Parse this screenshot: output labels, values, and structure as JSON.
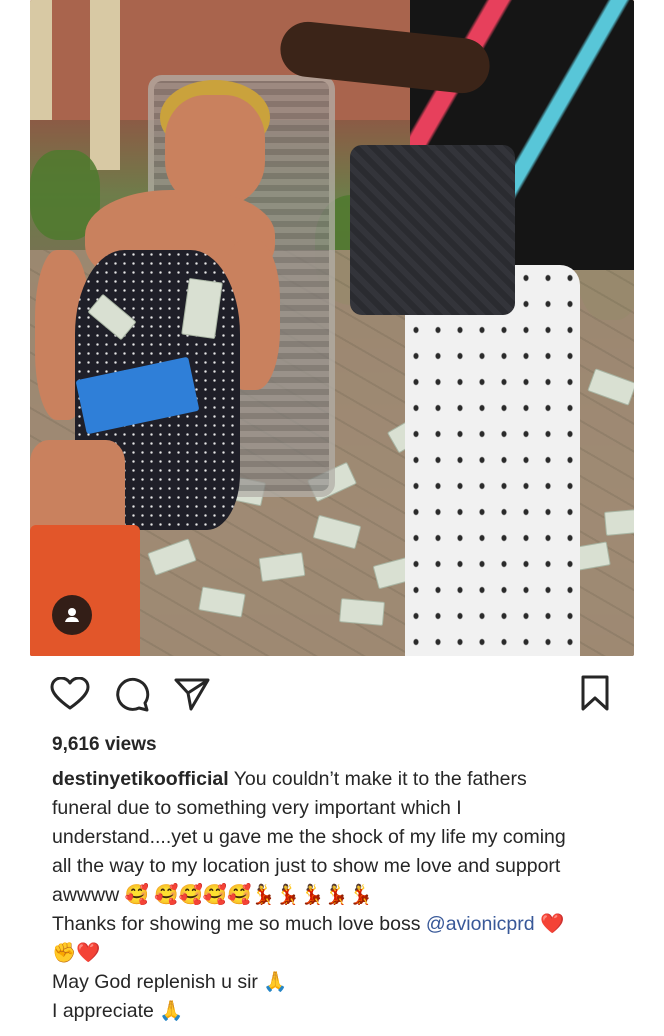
{
  "post": {
    "video_badge_icon": "user-tag-icon",
    "actions": {
      "like_icon": "heart-icon",
      "comment_icon": "comment-icon",
      "share_icon": "send-icon",
      "save_icon": "bookmark-icon"
    },
    "views": "9,616 views",
    "caption": {
      "username": "destinyetikoofficial",
      "line1": " You couldn’t make it to the fathers",
      "line2": "funeral due to something very important which I",
      "line3": "understand....yet u gave me the shock of my life my coming",
      "line4": "all the way to my location just to show me love and support",
      "line5": "awwww 🥰 🥰🥰🥰🥰💃💃💃💃💃",
      "line6_prefix": "Thanks for showing me so much love boss ",
      "mention": "@avionicprd",
      "line6_suffix": " ❤️",
      "line7": "✊❤️",
      "line8": "May God replenish u sir 🙏",
      "line9": "I appreciate 🙏"
    }
  }
}
